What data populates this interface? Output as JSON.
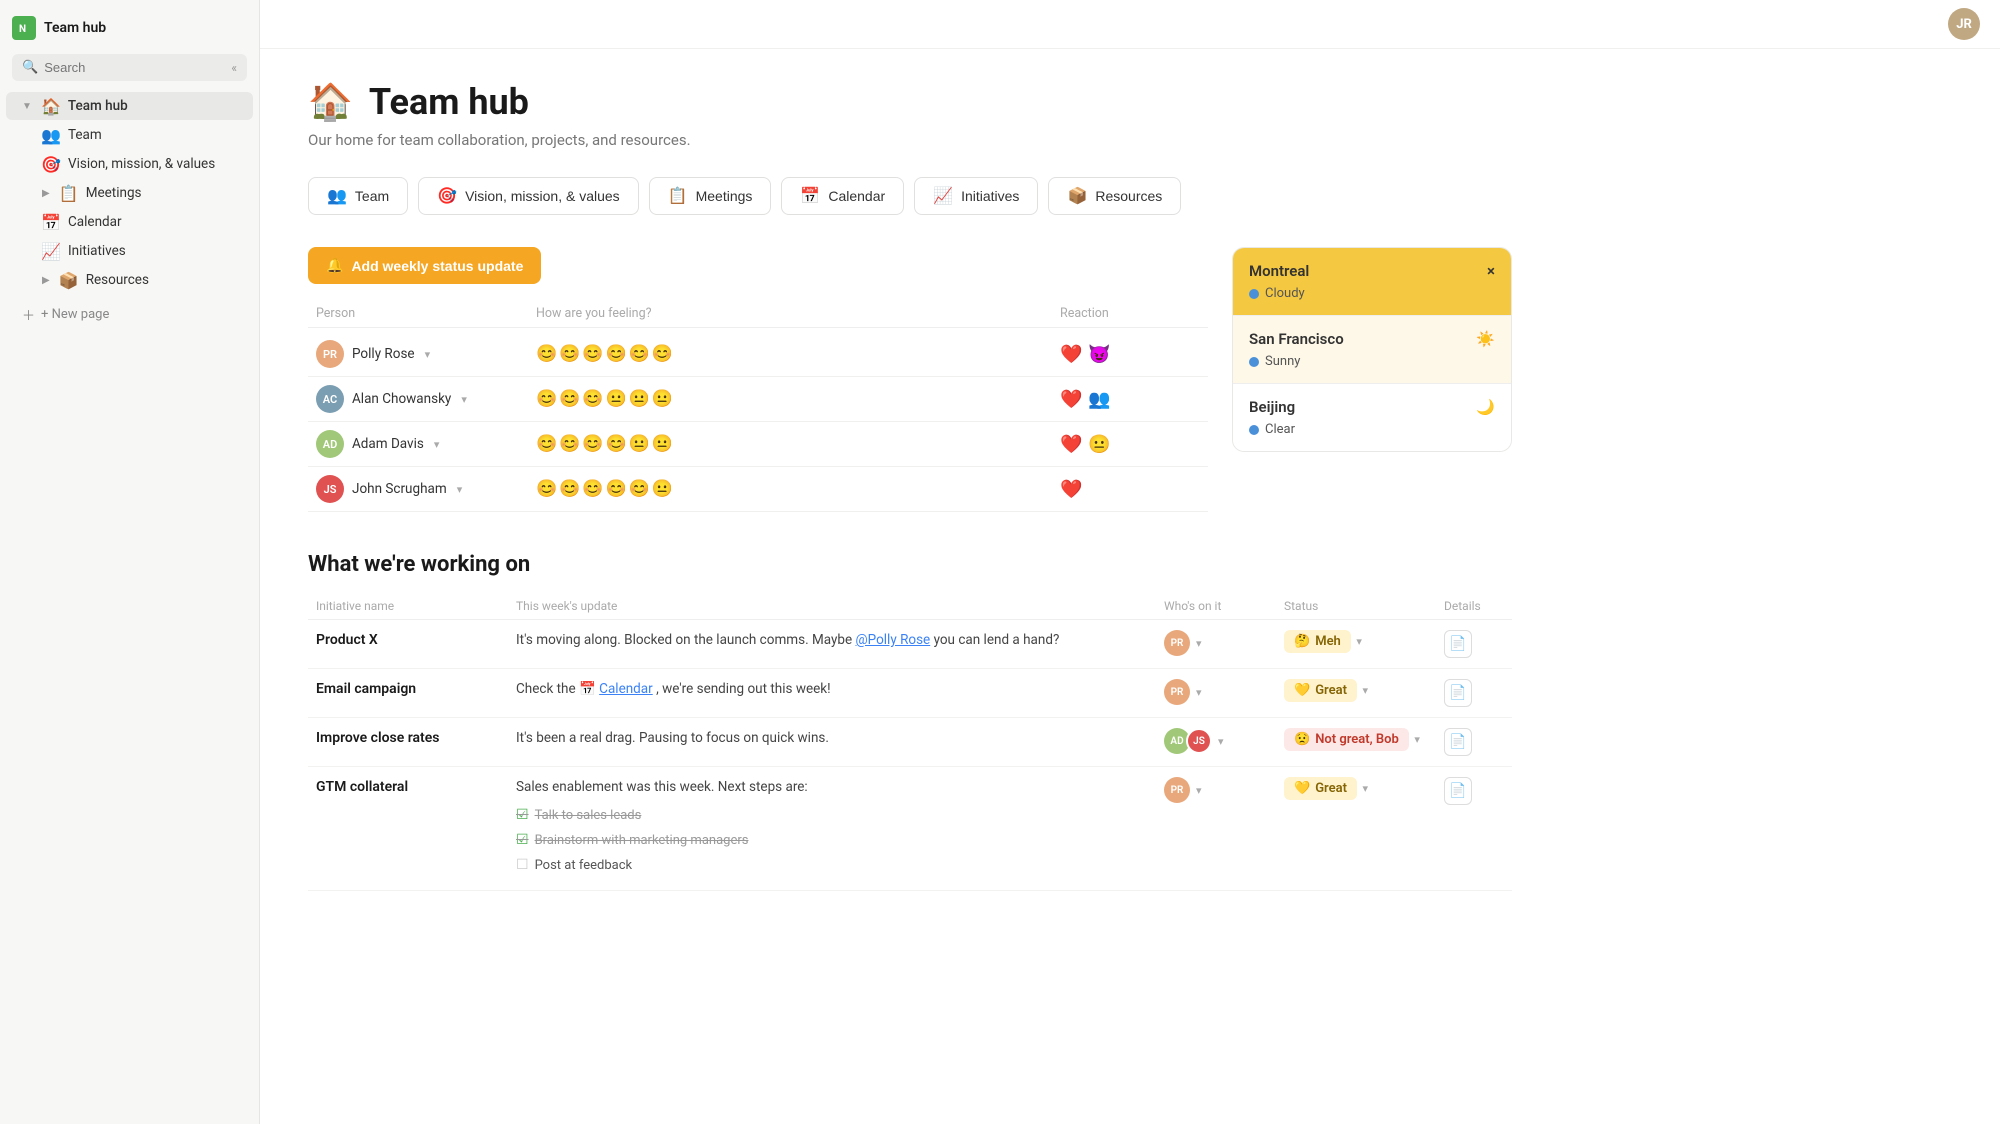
{
  "app": {
    "name": "Team hub",
    "icon_letter": "N"
  },
  "sidebar": {
    "search_placeholder": "Search",
    "items": [
      {
        "id": "team-hub",
        "label": "Team hub",
        "icon": "🏠",
        "active": true,
        "level": 0,
        "expandable": true
      },
      {
        "id": "team",
        "label": "Team",
        "icon": "👥",
        "active": false,
        "level": 1
      },
      {
        "id": "vision",
        "label": "Vision, mission, & values",
        "icon": "🎯",
        "active": false,
        "level": 1
      },
      {
        "id": "meetings",
        "label": "Meetings",
        "icon": "📋",
        "active": false,
        "level": 1,
        "expandable": true
      },
      {
        "id": "calendar",
        "label": "Calendar",
        "icon": "📅",
        "active": false,
        "level": 1
      },
      {
        "id": "initiatives",
        "label": "Initiatives",
        "icon": "📈",
        "active": false,
        "level": 1
      },
      {
        "id": "resources",
        "label": "Resources",
        "icon": "📦",
        "active": false,
        "level": 1,
        "expandable": true
      }
    ],
    "new_page": "+ New page"
  },
  "header": {
    "page_icon": "🏠",
    "title": "Team hub",
    "subtitle": "Our home for team collaboration, projects, and resources."
  },
  "tabs": [
    {
      "id": "team",
      "label": "Team",
      "icon": "👥"
    },
    {
      "id": "vision",
      "label": "Vision, mission, & values",
      "icon": "🎯"
    },
    {
      "id": "meetings",
      "label": "Meetings",
      "icon": "📋"
    },
    {
      "id": "calendar",
      "label": "Calendar",
      "icon": "📅"
    },
    {
      "id": "initiatives",
      "label": "Initiatives",
      "icon": "📈"
    },
    {
      "id": "resources",
      "label": "Resources",
      "icon": "📦"
    }
  ],
  "status_update": {
    "btn_label": "Add weekly status update",
    "btn_icon": "🔔"
  },
  "status_table": {
    "headers": {
      "person": "Person",
      "feeling": "How are you feeling?",
      "reaction": "Reaction"
    },
    "rows": [
      {
        "name": "Polly Rose",
        "avatar_color": "#e8a87c",
        "mood": "😊😊😊😊😊😊",
        "reaction": "❤️😈"
      },
      {
        "name": "Alan Chowansky",
        "avatar_color": "#7c9eb2",
        "mood": "😊😊😊😐😐",
        "reaction": "❤️👥"
      },
      {
        "name": "Adam Davis",
        "avatar_color": "#a0c878",
        "mood": "😊😊😊😊😐😐",
        "reaction": "❤️😐"
      },
      {
        "name": "John Scrugham",
        "avatar_color": "#e05252",
        "mood": "😊😊😊😊😊😐",
        "reaction": "❤️"
      }
    ]
  },
  "weather": {
    "cities": [
      {
        "name": "Montreal",
        "condition": "Cloudy",
        "temp": "",
        "highlighted": true
      },
      {
        "name": "San Francisco",
        "condition": "Sunny",
        "temp": "☀️",
        "highlighted": false,
        "light": true
      },
      {
        "name": "Beijing",
        "condition": "Clear",
        "temp": "🌙",
        "highlighted": false,
        "light": false
      }
    ]
  },
  "working_section": {
    "title": "What we're working on",
    "headers": {
      "initiative": "Initiative name",
      "update": "This week's update",
      "who": "Who's on it",
      "status": "Status",
      "details": "Details"
    },
    "rows": [
      {
        "name": "Product X",
        "update": "It's moving along. Blocked on the launch comms. Maybe @Polly Rose you can lend a hand?",
        "update_link": "@Polly Rose",
        "avatar_colors": [
          "#e8a87c"
        ],
        "status": "Meh",
        "status_type": "meh",
        "status_emoji": "🤔"
      },
      {
        "name": "Email campaign",
        "update": "Check the 📅 Calendar , we're sending out this week!",
        "update_link": "Calendar",
        "avatar_colors": [
          "#e8a87c"
        ],
        "status": "Great",
        "status_type": "great",
        "status_emoji": "💛"
      },
      {
        "name": "Improve close rates",
        "update": "It's been a real drag. Pausing to focus on quick wins.",
        "update_link": null,
        "avatar_colors": [
          "#a0c878",
          "#e05252"
        ],
        "status": "Not great, Bob",
        "status_type": "not-great",
        "status_emoji": "😟"
      },
      {
        "name": "GTM collateral",
        "update": "Sales enablement was this week. Next steps are:",
        "update_link": null,
        "avatar_colors": [
          "#e8a87c"
        ],
        "status": "Great",
        "status_type": "great",
        "status_emoji": "💛",
        "checklist": [
          {
            "text": "Talk to sales leads",
            "done": true
          },
          {
            "text": "Brainstorm with marketing managers",
            "done": true
          },
          {
            "text": "Post at feedback",
            "done": false
          }
        ]
      }
    ]
  }
}
